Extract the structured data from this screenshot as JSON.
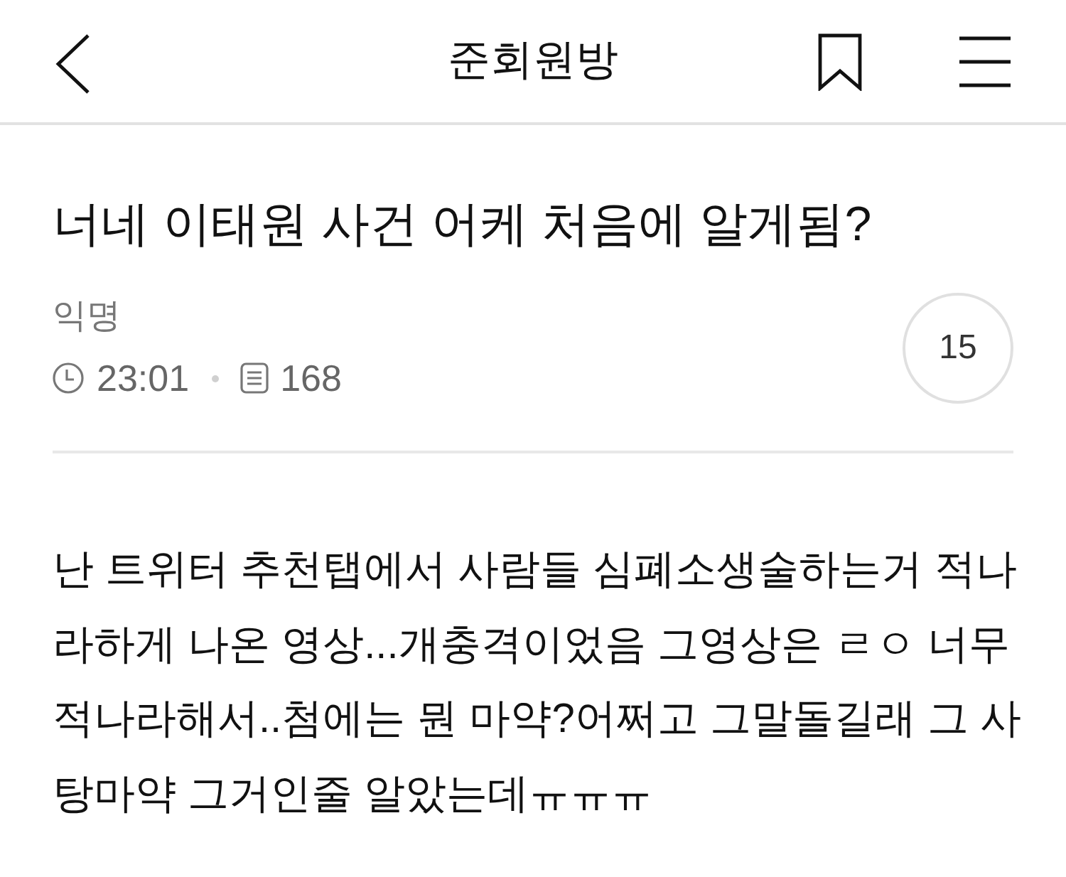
{
  "header": {
    "title": "준회원방"
  },
  "post": {
    "title": "너네 이태원 사건 어케 처음에 알게됨?",
    "author": "익명",
    "time": "23:01",
    "views": "168",
    "comment_count": "15"
  },
  "body": "난 트위터 추천탭에서 사람들 심폐소생술하는거 적나라하게 나온 영상...개충격이었음 그영상은 ㄹㅇ 너무 적나라해서..첨에는 뭔 마약?어쩌고 그말돌길래 그 사탕마약 그거인줄 알았는데ㅠㅠㅠ"
}
